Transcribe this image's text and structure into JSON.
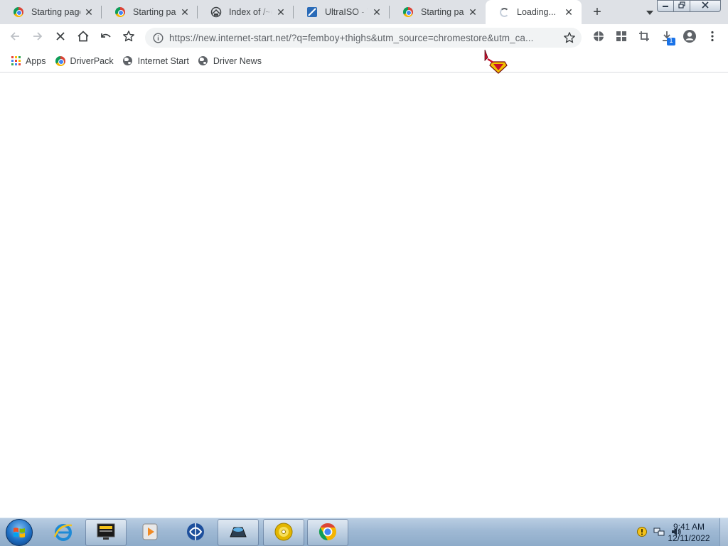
{
  "browser": {
    "tabs": [
      {
        "title": "Starting page",
        "icon": "chrome-icon",
        "active": false
      },
      {
        "title": "Starting page",
        "icon": "chrome-icon",
        "active": false
      },
      {
        "title": "Index of /~de",
        "icon": "index-page-icon",
        "active": false
      },
      {
        "title": "UltraISO - Th",
        "icon": "ultraiso-icon",
        "active": false
      },
      {
        "title": "Starting page",
        "icon": "chrome-icon",
        "active": false
      },
      {
        "title": "Loading...",
        "icon": "loading-spinner-icon",
        "active": true
      }
    ],
    "new_tab_symbol": "+",
    "address_bar": {
      "url": "https://new.internet-start.net/?q=femboy+thighs&utm_source=chromestore&utm_ca..."
    },
    "download_badge": "1",
    "bookmarks": [
      {
        "label": "Apps",
        "icon": "apps-grid-icon"
      },
      {
        "label": "DriverPack",
        "icon": "driverpack-icon"
      },
      {
        "label": "Internet Start",
        "icon": "globe-icon"
      },
      {
        "label": "Driver News",
        "icon": "globe-icon"
      }
    ]
  },
  "taskbar": {
    "items": [
      {
        "name": "internet-explorer-icon",
        "running": false
      },
      {
        "name": "media-center-icon",
        "running": true
      },
      {
        "name": "media-player-icon",
        "running": false
      },
      {
        "name": "network-globe-icon",
        "running": false
      },
      {
        "name": "app-icon",
        "running": true
      },
      {
        "name": "cd-disc-icon",
        "running": true
      },
      {
        "name": "chrome-taskbar-icon",
        "running": true
      }
    ],
    "clock": {
      "time": "9:41 AM",
      "date": "12/11/2022"
    }
  },
  "colors": {
    "tabstrip": "#dee1e6",
    "omnibox": "#f1f3f4",
    "taskbar": "#9fb9d4"
  }
}
